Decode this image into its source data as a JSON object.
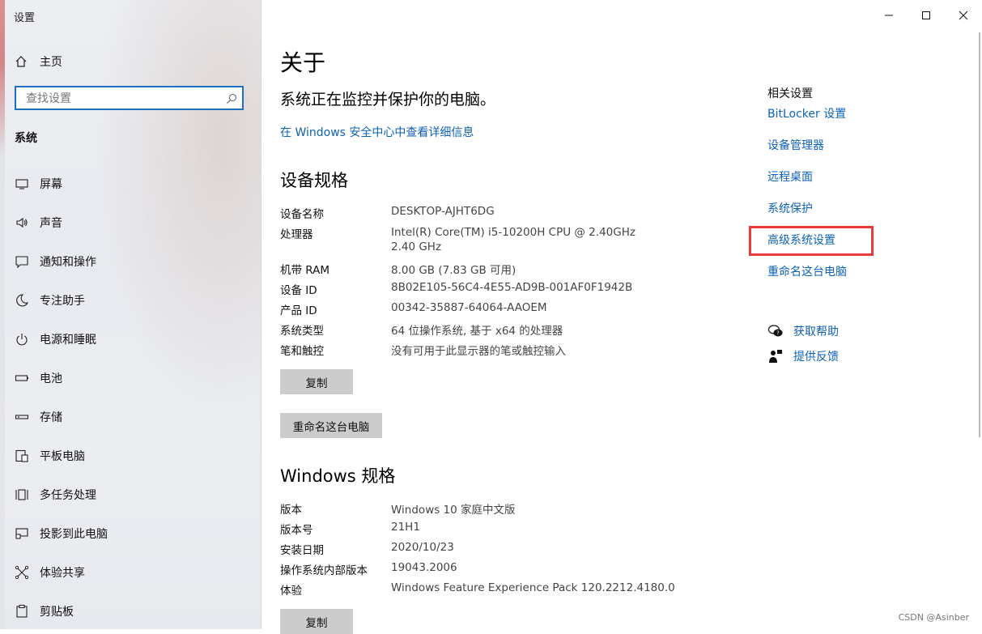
{
  "window": {
    "title": "设置"
  },
  "sidebar": {
    "home_label": "主页",
    "search_placeholder": "查找设置",
    "section_label": "系统",
    "items": [
      {
        "label": "屏幕",
        "icon": "display-icon"
      },
      {
        "label": "声音",
        "icon": "speaker-icon"
      },
      {
        "label": "通知和操作",
        "icon": "notification-icon"
      },
      {
        "label": "专注助手",
        "icon": "moon-icon"
      },
      {
        "label": "电源和睡眠",
        "icon": "power-icon"
      },
      {
        "label": "电池",
        "icon": "battery-icon"
      },
      {
        "label": "存储",
        "icon": "storage-icon"
      },
      {
        "label": "平板电脑",
        "icon": "tablet-icon"
      },
      {
        "label": "多任务处理",
        "icon": "multitask-icon"
      },
      {
        "label": "投影到此电脑",
        "icon": "project-icon"
      },
      {
        "label": "体验共享",
        "icon": "share-icon"
      },
      {
        "label": "剪贴板",
        "icon": "clipboard-icon"
      }
    ]
  },
  "main": {
    "title": "关于",
    "protection_text": "系统正在监控并保护你的电脑。",
    "security_link": "在 Windows 安全中心中查看详细信息",
    "device_specs": {
      "heading": "设备规格",
      "rows": [
        {
          "key": "设备名称",
          "value": "DESKTOP-AJHT6DG"
        },
        {
          "key": "处理器",
          "value": "Intel(R) Core(TM) i5-10200H CPU @ 2.40GHz",
          "value2": "2.40 GHz"
        },
        {
          "key": "机带 RAM",
          "value": "8.00 GB (7.83 GB 可用)"
        },
        {
          "key": "设备 ID",
          "value": "8B02E105-56C4-4E55-AD9B-001AF0F1942B"
        },
        {
          "key": "产品 ID",
          "value": "00342-35887-64064-AAOEM"
        },
        {
          "key": "系统类型",
          "value": "64 位操作系统, 基于 x64 的处理器"
        },
        {
          "key": "笔和触控",
          "value": "没有可用于此显示器的笔或触控输入"
        }
      ],
      "copy_button": "复制",
      "rename_button": "重命名这台电脑"
    },
    "windows_specs": {
      "heading": "Windows 规格",
      "rows": [
        {
          "key": "版本",
          "value": "Windows 10 家庭中文版"
        },
        {
          "key": "版本号",
          "value": "21H1"
        },
        {
          "key": "安装日期",
          "value": "2020/10/23"
        },
        {
          "key": "操作系统内部版本",
          "value": "19043.2006"
        },
        {
          "key": "体验",
          "value": "Windows Feature Experience Pack 120.2212.4180.0"
        }
      ],
      "copy_button": "复制"
    }
  },
  "related": {
    "title": "相关设置",
    "links": [
      "BitLocker 设置",
      "设备管理器",
      "远程桌面",
      "系统保护",
      "高级系统设置",
      "重命名这台电脑"
    ],
    "highlight_color": "#e83a3a",
    "help_label": "获取帮助",
    "feedback_label": "提供反馈"
  },
  "watermark": "CSDN @Asinber",
  "colors": {
    "accent": "#0f62b4",
    "search_border": "#1e6fc2",
    "button_bg": "#cccccc"
  }
}
